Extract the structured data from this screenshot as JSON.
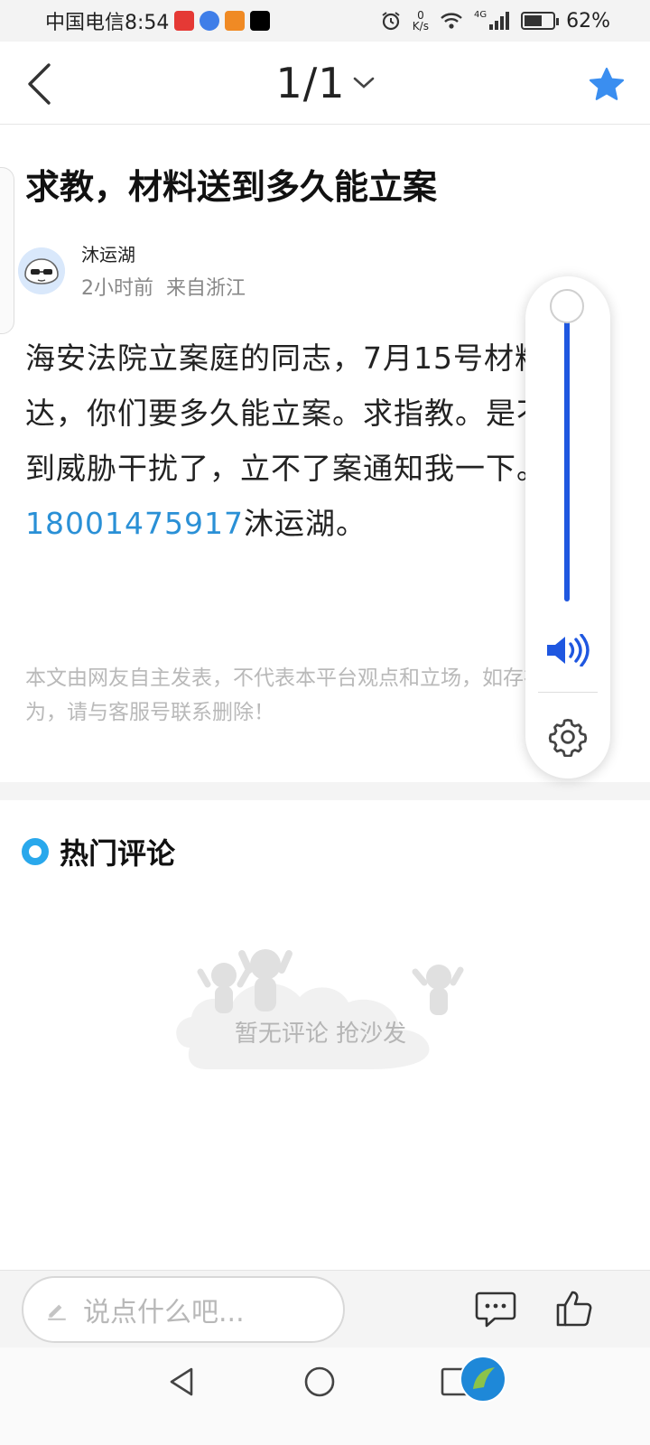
{
  "status_bar": {
    "carrier_time": "中国电信8:54",
    "speed_value": "0",
    "speed_unit": "K/s",
    "network": "4G",
    "battery": "62%",
    "battery_level": 0.62
  },
  "nav": {
    "page_indicator": "1/1"
  },
  "post": {
    "title": "求教，材料送到多久能立案",
    "author": "沐运湖",
    "time": "2小时前",
    "location": "来自浙江",
    "body_before": "海安法院立案庭的同志，7月15号材料送达，你们要多久能立案。求指教。是不是受到威胁干扰了，立不了案通知我一下。电话",
    "phone": "18001475917",
    "body_after": "沐运湖。",
    "disclaimer": "本文由网友自主发表，不代表本平台观点和立场，如存在侵权行为，请与客服号联系删除！"
  },
  "comments": {
    "section_title": "热门评论",
    "empty_text": "暂无评论 抢沙发"
  },
  "volume": {
    "level": 1.0
  },
  "bottom_bar": {
    "input_placeholder": "说点什么吧..."
  },
  "colors": {
    "accent_blue": "#2a90d6",
    "volume_blue": "#1f57e0",
    "hot_dot": "#29a8ec",
    "star": "#3a8ef0"
  },
  "icons": {
    "back": "chevron-left-icon",
    "dropdown": "chevron-down-icon",
    "favorite": "star-icon",
    "speaker": "speaker-icon",
    "settings": "gear-icon",
    "comment": "comment-icon",
    "like": "thumbs-up-icon",
    "edit": "pencil-icon"
  }
}
